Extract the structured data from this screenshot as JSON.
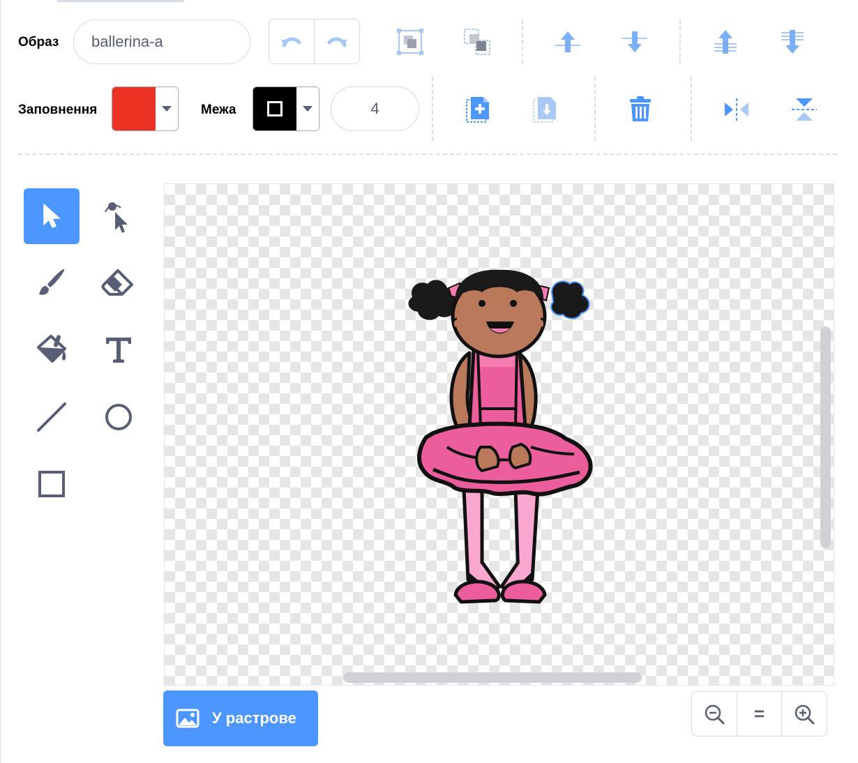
{
  "toolbar": {
    "costume_label": "Образ",
    "costume_name": "ballerina-a",
    "fill_label": "Заповнення",
    "fill_color": "#ec3223",
    "outline_label": "Межа",
    "outline_color": "#000000",
    "outline_width": "4"
  },
  "tools": [
    {
      "name": "select",
      "icon": "arrow-pointer-icon",
      "active": true
    },
    {
      "name": "reshape",
      "icon": "reshape-icon",
      "active": false
    },
    {
      "name": "brush",
      "icon": "brush-icon",
      "active": false
    },
    {
      "name": "eraser",
      "icon": "eraser-icon",
      "active": false
    },
    {
      "name": "fill",
      "icon": "paint-bucket-icon",
      "active": false
    },
    {
      "name": "text",
      "icon": "text-icon",
      "active": false
    },
    {
      "name": "line",
      "icon": "line-icon",
      "active": false
    },
    {
      "name": "circle",
      "icon": "circle-icon",
      "active": false
    },
    {
      "name": "rectangle",
      "icon": "rectangle-icon",
      "active": false
    }
  ],
  "bottom": {
    "convert_label": "У растрове",
    "zoom_reset_label": "="
  },
  "colors": {
    "accent": "#4c97ff",
    "skin": "#b9795a",
    "pink": "#ec5d9b",
    "light_pink": "#f9a7cf"
  }
}
